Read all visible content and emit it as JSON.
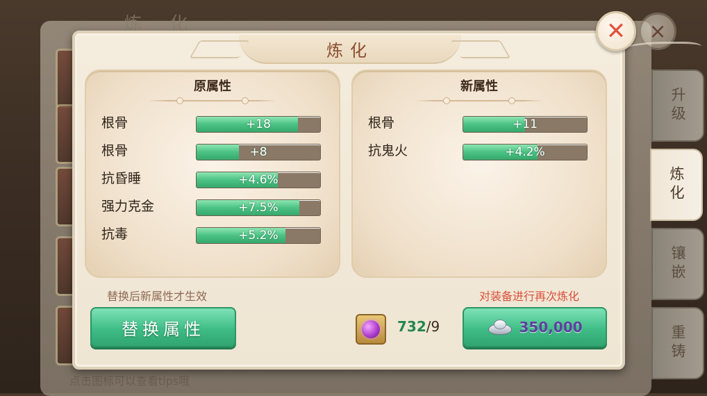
{
  "background": {
    "title": "炼 化",
    "hint": "点击图标可以查看tips哦"
  },
  "side_tabs": [
    {
      "label": "升级",
      "active": false
    },
    {
      "label": "炼化",
      "active": true
    },
    {
      "label": "镶嵌",
      "active": false
    },
    {
      "label": "重铸",
      "active": false
    }
  ],
  "dialog": {
    "title": "炼化",
    "original": {
      "header": "原属性",
      "rows": [
        {
          "name": "根骨",
          "value": "+18",
          "fill": 0.82
        },
        {
          "name": "根骨",
          "value": "+8",
          "fill": 0.34
        },
        {
          "name": "抗昏睡",
          "value": "+4.6%",
          "fill": 0.66
        },
        {
          "name": "强力克金",
          "value": "+7.5%",
          "fill": 0.83
        },
        {
          "name": "抗毒",
          "value": "+5.2%",
          "fill": 0.72
        }
      ]
    },
    "new": {
      "header": "新属性",
      "rows": [
        {
          "name": "根骨",
          "value": "+11",
          "fill": 0.5
        },
        {
          "name": "抗鬼火",
          "value": "+4.2%",
          "fill": 0.6
        }
      ]
    },
    "note_left": "替换后新属性才生效",
    "note_right": "对装备进行再次炼化",
    "replace_button": "替换属性",
    "material": {
      "have": "732",
      "need": "/9",
      "icon": "purple-gem-icon"
    },
    "refine_cost": "350,000",
    "colors": {
      "accent_green": "#3fbd87",
      "warning_red": "#d9503b",
      "cost_purple": "#5e3f9e"
    }
  }
}
